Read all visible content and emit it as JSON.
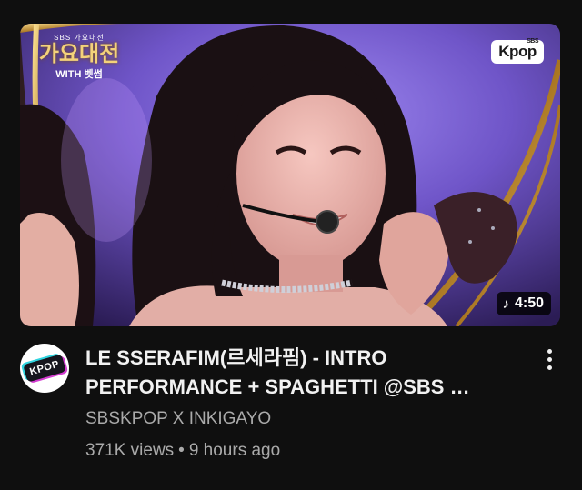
{
  "video": {
    "title": "LE SSERAFIM(르세라핌) - INTRO PERFORMANCE + SPAGHETTI @SBS …",
    "title_line1": "LE SSERAFIM(르세라핌) - INTRO",
    "title_line2": "PERFORMANCE + SPAGHETTI @SBS …",
    "channel": "SBSKPOP X INKIGAYO",
    "views": "371K views",
    "separator": "•",
    "age": "9 hours ago",
    "duration": "4:50",
    "duration_icon": "music-note-icon"
  },
  "thumbnail": {
    "corner_logo": "Kpop",
    "corner_logo_small": "SBS",
    "show_logo_top": "SBS 가요대전",
    "show_logo_main": "가요대전",
    "show_logo_sub": "WITH 벳썸"
  },
  "avatar": {
    "label": "KPOP"
  },
  "menu": {
    "icon": "more-vertical-icon"
  },
  "colors": {
    "background": "#0f0f0f",
    "title": "#f1f1f1",
    "secondary": "#aaaaaa",
    "stage_purple": "#7a5cd6"
  }
}
